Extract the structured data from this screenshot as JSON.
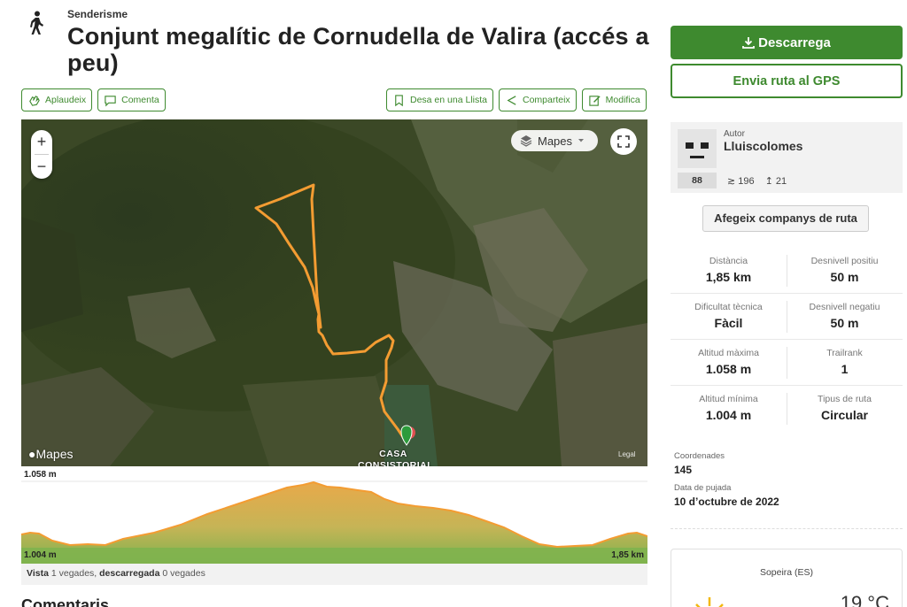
{
  "header": {
    "category": "Senderisme",
    "title": "Conjunt megalític de Cornudella de Valira (accés a peu)"
  },
  "actions_left": [
    {
      "label": "Aplaudeix",
      "icon": "clap-icon"
    },
    {
      "label": "Comenta",
      "icon": "comment-icon"
    }
  ],
  "actions_right": [
    {
      "label": "Desa en una Llista",
      "icon": "bookmark-icon"
    },
    {
      "label": "Comparteix",
      "icon": "share-icon"
    },
    {
      "label": "Modifica",
      "icon": "edit-icon"
    }
  ],
  "map": {
    "zoom_in": "+",
    "zoom_out": "−",
    "type_selector": "Mapes",
    "apple_logo": "Mapes",
    "legal": "Legal",
    "place_label": "CASA CONSISTORIAL"
  },
  "profile": {
    "max_elevation": "1.058 m",
    "min_elevation": "1.004 m",
    "distance": "1,85 km"
  },
  "views": {
    "vista_label": "Vista",
    "vista_count": "1 vegades,",
    "download_label": "descarregada",
    "download_count": "0 vegades"
  },
  "comments_heading": "Comentaris",
  "sidebar": {
    "download_label": "Descarrega",
    "gps_label": "Envia ruta al GPS",
    "author_label": "Autor",
    "author_name": "Lluiscolomes",
    "rank": "88",
    "followers": "196",
    "following": "21",
    "add_companions": "Afegeix companys de ruta"
  },
  "stats": [
    {
      "left": {
        "k": "Distància",
        "v": "1,85 km"
      },
      "right": {
        "k": "Desnivell positiu",
        "v": "50 m"
      }
    },
    {
      "left": {
        "k": "Dificultat tècnica",
        "v": "Fàcil"
      },
      "right": {
        "k": "Desnivell negatiu",
        "v": "50 m"
      }
    },
    {
      "left": {
        "k": "Altitud màxima",
        "v": "1.058 m"
      },
      "right": {
        "k": "Trailrank",
        "v": "1"
      }
    },
    {
      "left": {
        "k": "Altitud mínima",
        "v": "1.004 m"
      },
      "right": {
        "k": "Tipus de ruta",
        "v": "Circular"
      }
    }
  ],
  "meta": {
    "coords_label": "Coordenades",
    "coords_value": "145",
    "upload_label": "Data de pujada",
    "upload_value": "10 d’octubre de 2022"
  },
  "weather": {
    "location": "Sopeira (ES)",
    "temperature": "19 °C"
  },
  "colors": {
    "brand_green": "#3e8a2f",
    "track_orange": "#f39c32"
  }
}
